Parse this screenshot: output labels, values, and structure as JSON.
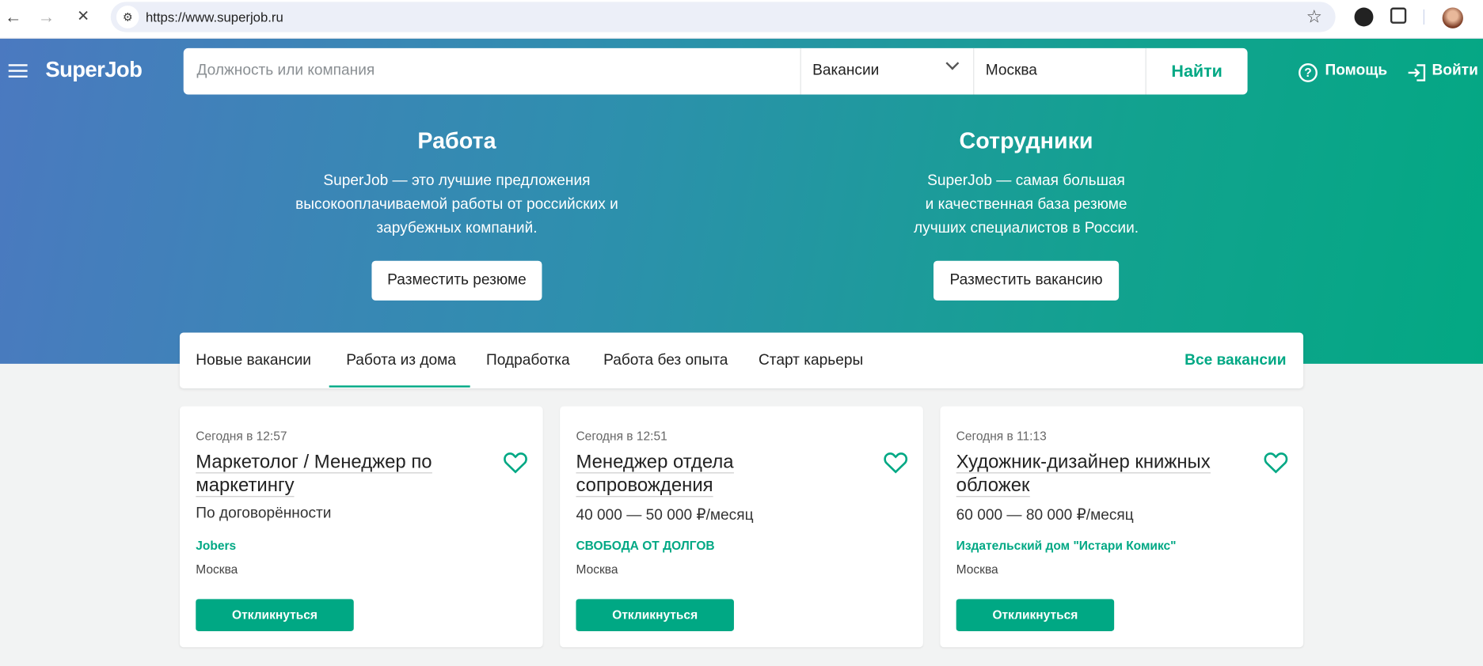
{
  "browser": {
    "url": "https://www.superjob.ru",
    "back": "←",
    "forward": "→",
    "stop": "✕",
    "star": "☆"
  },
  "header": {
    "logo": "SuperJob",
    "search_placeholder": "Должность или компания",
    "type_select": "Вакансии",
    "city": "Москва",
    "search_button": "Найти",
    "help": "Помощь",
    "login": "Войти"
  },
  "promo": [
    {
      "title": "Работа",
      "lines": [
        "SuperJob — это лучшие предложения",
        "высокооплачиваемой работы от российских и",
        "зарубежных компаний."
      ],
      "button": "Разместить резюме"
    },
    {
      "title": "Сотрудники",
      "lines": [
        "SuperJob — самая большая",
        "и качественная база резюме",
        "лучших специалистов в России."
      ],
      "button": "Разместить вакансию"
    }
  ],
  "tabs": {
    "items": [
      "Новые вакансии",
      "Работа из дома",
      "Подработка",
      "Работа без опыта",
      "Старт карьеры"
    ],
    "active": 1,
    "all": "Все вакансии"
  },
  "cards": [
    {
      "date": "Сегодня в 12:57",
      "title": "Маркетолог / Менеджер по маркетингу",
      "salary": "По договорённости",
      "company": "Jobers",
      "city": "Москва",
      "button": "Откликнуться"
    },
    {
      "date": "Сегодня в 12:51",
      "title": "Менеджер отдела сопровождения",
      "salary": "40 000 — 50 000 ₽/месяц",
      "company": "СВОБОДА ОТ ДОЛГОВ",
      "city": "Москва",
      "button": "Откликнуться"
    },
    {
      "date": "Сегодня в 11:13",
      "title": "Художник-дизайнер книжных обложек",
      "salary": "60 000 — 80 000 ₽/месяц",
      "company": "Издательский дом \"Истари Комикс\"",
      "city": "Москва",
      "button": "Откликнуться"
    }
  ],
  "colors": {
    "accent": "#00a884",
    "gradient_start": "#4b79c0",
    "gradient_end": "#03a883"
  }
}
